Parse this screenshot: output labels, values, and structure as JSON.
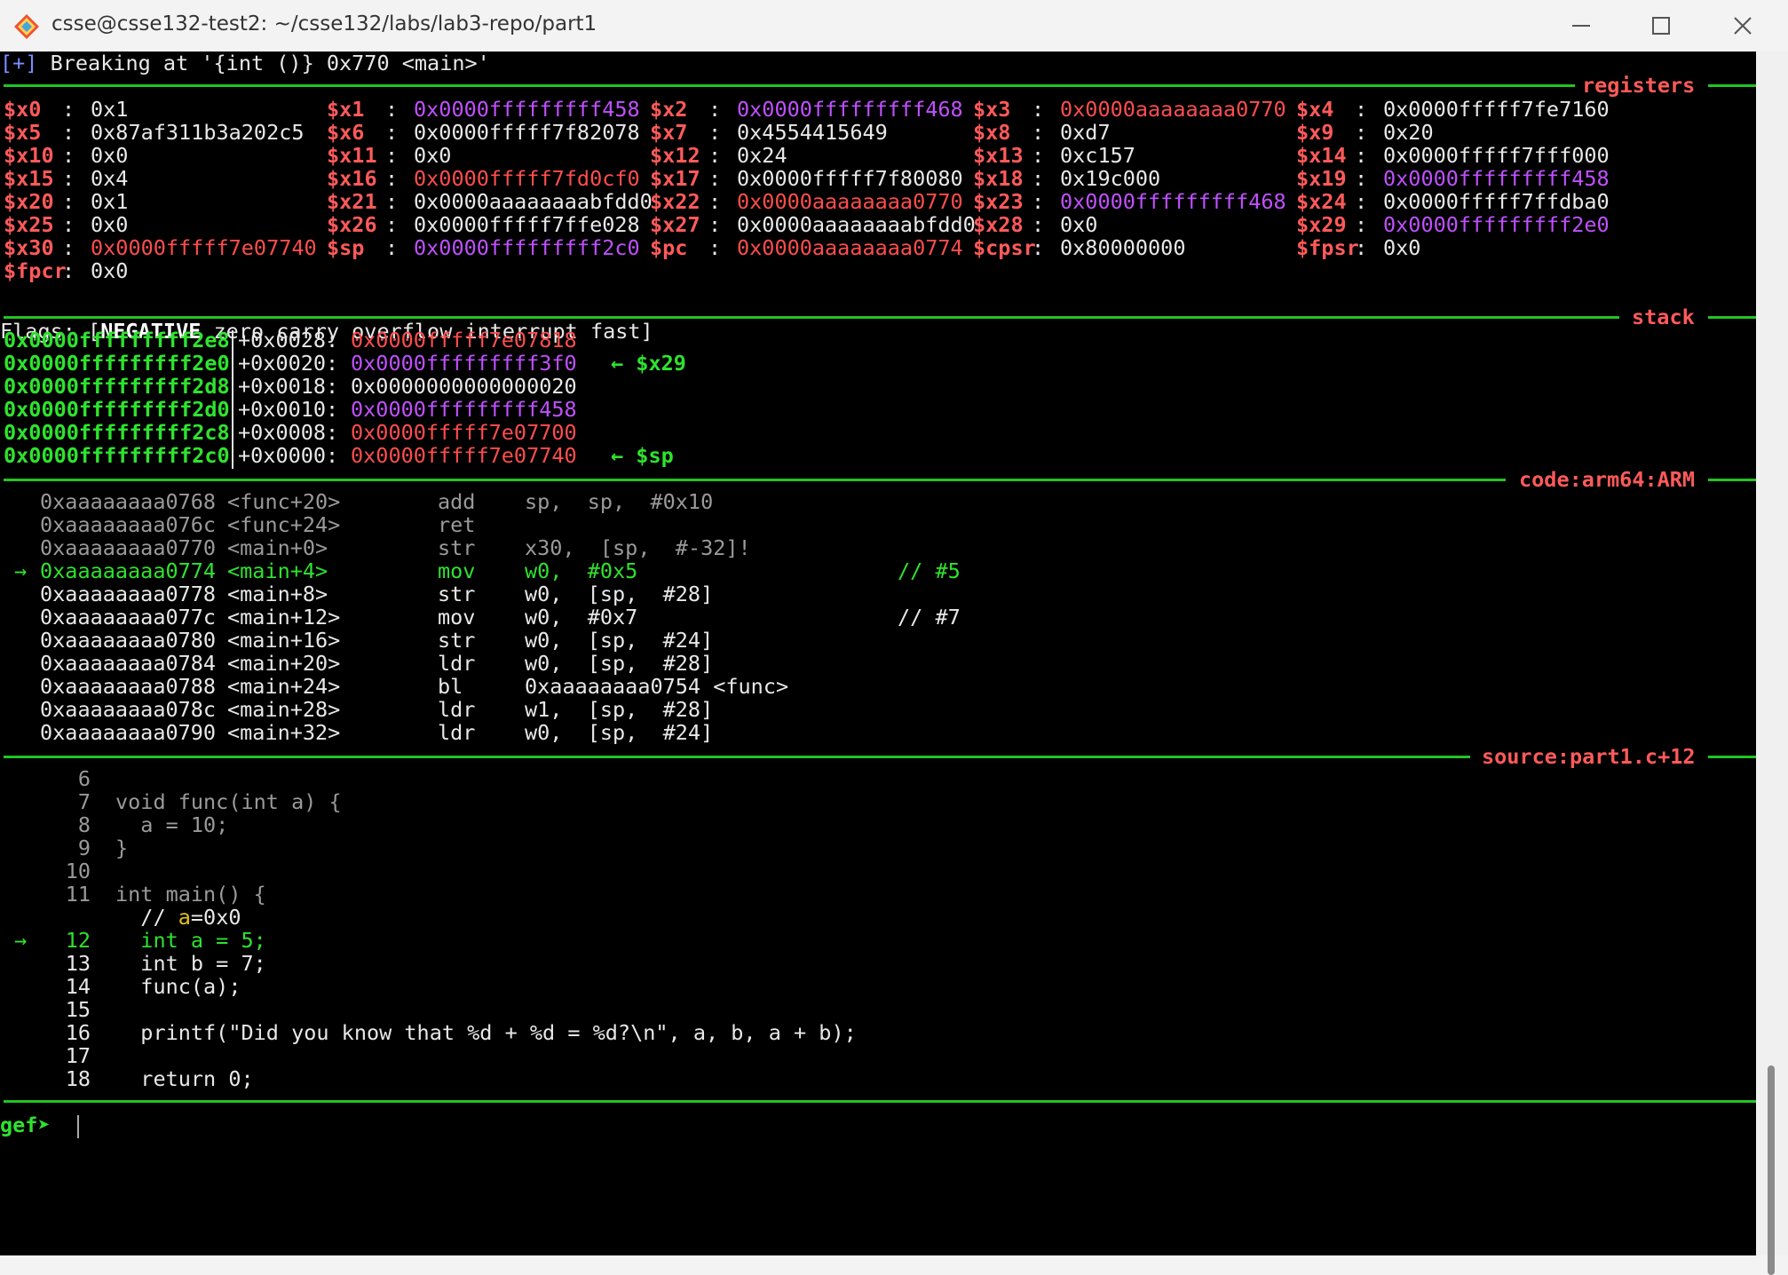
{
  "window": {
    "title": "csse@csse132-test2: ~/csse132/labs/lab3-repo/part1",
    "controls": [
      "minimize-icon",
      "maximize-icon",
      "close-icon"
    ]
  },
  "breaking": {
    "prefix": "[+]",
    "text": " Breaking at '{int ()} 0x770 <main>'"
  },
  "sections": {
    "registers": "registers",
    "stack": "stack",
    "code": "code:arm64:ARM",
    "source": "source:part1.c+12"
  },
  "registers": [
    [
      {
        "name": "$x0",
        "value": "0x1",
        "color": "white"
      },
      {
        "name": "$x1",
        "value": "0x0000fffffffff458",
        "color": "purple"
      },
      {
        "name": "$x2",
        "value": "0x0000fffffffff468",
        "color": "purple"
      },
      {
        "name": "$x3",
        "value": "0x0000aaaaaaaa0770",
        "color": "red"
      },
      {
        "name": "$x4",
        "value": "0x0000fffff7fe7160",
        "color": "white"
      }
    ],
    [
      {
        "name": "$x5",
        "value": "0x87af311b3a202c5",
        "color": "white"
      },
      {
        "name": "$x6",
        "value": "0x0000fffff7f82078",
        "color": "white"
      },
      {
        "name": "$x7",
        "value": "0x4554415649",
        "color": "white"
      },
      {
        "name": "$x8",
        "value": "0xd7",
        "color": "white"
      },
      {
        "name": "$x9",
        "value": "0x20",
        "color": "white"
      }
    ],
    [
      {
        "name": "$x10",
        "value": "0x0",
        "color": "white"
      },
      {
        "name": "$x11",
        "value": "0x0",
        "color": "white"
      },
      {
        "name": "$x12",
        "value": "0x24",
        "color": "white"
      },
      {
        "name": "$x13",
        "value": "0xc157",
        "color": "white"
      },
      {
        "name": "$x14",
        "value": "0x0000fffff7fff000",
        "color": "white"
      }
    ],
    [
      {
        "name": "$x15",
        "value": "0x4",
        "color": "white"
      },
      {
        "name": "$x16",
        "value": "0x0000fffff7fd0cf0",
        "color": "red"
      },
      {
        "name": "$x17",
        "value": "0x0000fffff7f80080",
        "color": "white"
      },
      {
        "name": "$x18",
        "value": "0x19c000",
        "color": "white"
      },
      {
        "name": "$x19",
        "value": "0x0000fffffffff458",
        "color": "purple"
      }
    ],
    [
      {
        "name": "$x20",
        "value": "0x1",
        "color": "white"
      },
      {
        "name": "$x21",
        "value": "0x0000aaaaaaaabfdd0",
        "color": "white"
      },
      {
        "name": "$x22",
        "value": "0x0000aaaaaaaa0770",
        "color": "red"
      },
      {
        "name": "$x23",
        "value": "0x0000fffffffff468",
        "color": "purple"
      },
      {
        "name": "$x24",
        "value": "0x0000fffff7ffdba0",
        "color": "white"
      }
    ],
    [
      {
        "name": "$x25",
        "value": "0x0",
        "color": "white"
      },
      {
        "name": "$x26",
        "value": "0x0000fffff7ffe028",
        "color": "white"
      },
      {
        "name": "$x27",
        "value": "0x0000aaaaaaaabfdd0",
        "color": "white"
      },
      {
        "name": "$x28",
        "value": "0x0",
        "color": "white"
      },
      {
        "name": "$x29",
        "value": "0x0000fffffffff2e0",
        "color": "purple"
      }
    ],
    [
      {
        "name": "$x30",
        "value": "0x0000fffff7e07740",
        "color": "red"
      },
      {
        "name": "$sp",
        "value": "0x0000fffffffff2c0",
        "color": "purple"
      },
      {
        "name": "$pc",
        "value": "0x0000aaaaaaaa0774",
        "color": "red"
      },
      {
        "name": "$cpsr",
        "value": "0x80000000",
        "color": "white"
      },
      {
        "name": "$fpsr",
        "value": "0x0",
        "color": "white"
      }
    ],
    [
      {
        "name": "$fpcr",
        "value": "0x0",
        "color": "white"
      }
    ]
  ],
  "flags": {
    "prefix": "Flags: [",
    "negative": "NEGATIVE",
    "rest": " zero carry overflow interrupt fast]"
  },
  "stack": [
    {
      "addr": "0x0000fffffffff2e8",
      "offset": "+0x0028:",
      "value": "0x0000fffff7e07818",
      "color": "red",
      "arrow": ""
    },
    {
      "addr": "0x0000fffffffff2e0",
      "offset": "+0x0020:",
      "value": "0x0000fffffffff3f0",
      "color": "purple",
      "arrow": "← $x29"
    },
    {
      "addr": "0x0000fffffffff2d8",
      "offset": "+0x0018:",
      "value": "0x0000000000000020",
      "color": "white",
      "arrow": ""
    },
    {
      "addr": "0x0000fffffffff2d0",
      "offset": "+0x0010:",
      "value": "0x0000fffffffff458",
      "color": "purple",
      "arrow": ""
    },
    {
      "addr": "0x0000fffffffff2c8",
      "offset": "+0x0008:",
      "value": "0x0000fffff7e07700",
      "color": "red",
      "arrow": ""
    },
    {
      "addr": "0x0000fffffffff2c0",
      "offset": "+0x0000:",
      "value": "0x0000fffff7e07740",
      "color": "red",
      "arrow": "← $sp"
    }
  ],
  "code": [
    {
      "marker": "",
      "addr": "0xaaaaaaaa0768",
      "sym": "<func+20>",
      "op": "add",
      "args": "sp,  sp,  #0x10",
      "comment": "",
      "style": "gray"
    },
    {
      "marker": "",
      "addr": "0xaaaaaaaa076c",
      "sym": "<func+24>",
      "op": "ret",
      "args": "",
      "comment": "",
      "style": "gray"
    },
    {
      "marker": "",
      "addr": "0xaaaaaaaa0770",
      "sym": "<main+0>",
      "op": "str",
      "args": "x30,  [sp,  #-32]!",
      "comment": "",
      "style": "gray"
    },
    {
      "marker": "→",
      "addr": "0xaaaaaaaa0774",
      "sym": "<main+4>",
      "op": "mov",
      "args": "w0,  #0x5",
      "comment": "// #5",
      "style": "green"
    },
    {
      "marker": "",
      "addr": "0xaaaaaaaa0778",
      "sym": "<main+8>",
      "op": "str",
      "args": "w0,  [sp,  #28]",
      "comment": "",
      "style": "white"
    },
    {
      "marker": "",
      "addr": "0xaaaaaaaa077c",
      "sym": "<main+12>",
      "op": "mov",
      "args": "w0,  #0x7",
      "comment": "// #7",
      "style": "white"
    },
    {
      "marker": "",
      "addr": "0xaaaaaaaa0780",
      "sym": "<main+16>",
      "op": "str",
      "args": "w0,  [sp,  #24]",
      "comment": "",
      "style": "white"
    },
    {
      "marker": "",
      "addr": "0xaaaaaaaa0784",
      "sym": "<main+20>",
      "op": "ldr",
      "args": "w0,  [sp,  #28]",
      "comment": "",
      "style": "white"
    },
    {
      "marker": "",
      "addr": "0xaaaaaaaa0788",
      "sym": "<main+24>",
      "op": "bl",
      "args": "0xaaaaaaaa0754 <func>",
      "comment": "",
      "style": "white"
    },
    {
      "marker": "",
      "addr": "0xaaaaaaaa078c",
      "sym": "<main+28>",
      "op": "ldr",
      "args": "w1,  [sp,  #28]",
      "comment": "",
      "style": "white"
    },
    {
      "marker": "",
      "addr": "0xaaaaaaaa0790",
      "sym": "<main+32>",
      "op": "ldr",
      "args": "w0,  [sp,  #24]",
      "comment": "",
      "style": "white"
    }
  ],
  "source": [
    {
      "marker": "",
      "num": "6",
      "text": "",
      "style": "gray"
    },
    {
      "marker": "",
      "num": "7",
      "text": "void func(int a) {",
      "style": "gray"
    },
    {
      "marker": "",
      "num": "8",
      "text": "  a = 10;",
      "style": "gray"
    },
    {
      "marker": "",
      "num": "9",
      "text": "}",
      "style": "gray"
    },
    {
      "marker": "",
      "num": "10",
      "text": "",
      "style": "gray"
    },
    {
      "marker": "",
      "num": "11",
      "text": "int main() {",
      "style": "gray"
    },
    {
      "marker": "",
      "num": "",
      "text": "  // a=0x0",
      "style": "comment"
    },
    {
      "marker": "→",
      "num": "12",
      "text": "  int a = 5;",
      "style": "green"
    },
    {
      "marker": "",
      "num": "13",
      "text": "  int b = 7;",
      "style": "white"
    },
    {
      "marker": "",
      "num": "14",
      "text": "  func(a);",
      "style": "white"
    },
    {
      "marker": "",
      "num": "15",
      "text": "",
      "style": "white"
    },
    {
      "marker": "",
      "num": "16",
      "text": "  printf(\"Did you know that %d + %d = %d?\\n\", a, b, a + b);",
      "style": "white"
    },
    {
      "marker": "",
      "num": "17",
      "text": "",
      "style": "white"
    },
    {
      "marker": "",
      "num": "18",
      "text": "  return 0;",
      "style": "white"
    }
  ],
  "prompt": {
    "text": "gef➤",
    "input": ""
  },
  "colors": {
    "separator": "#22c422",
    "section_label": "#ff5a5a",
    "register_name": "#ff5a5a",
    "address_green": "#2ee32e",
    "pointer_red": "#ff4d4d",
    "pointer_purple": "#c050ff",
    "dim": "#9a9a9a"
  }
}
